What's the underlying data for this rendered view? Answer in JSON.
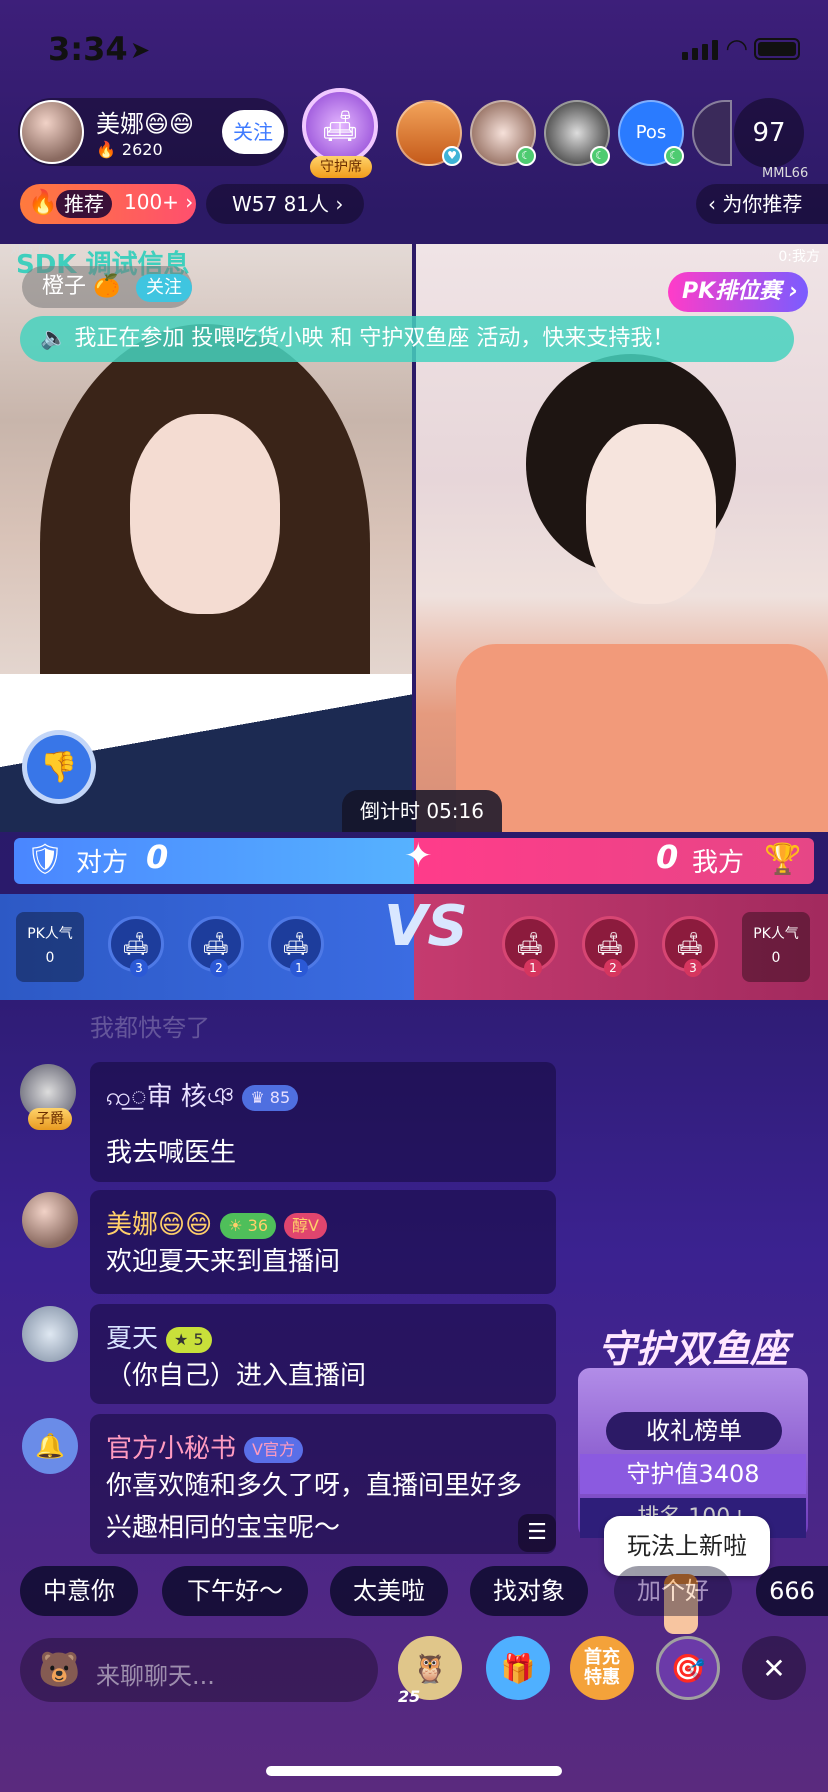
{
  "status_bar": {
    "time": "3:34",
    "location_icon": "location-arrow-icon"
  },
  "host": {
    "name": "美娜😄😄",
    "heat": "2620",
    "follow_label": "关注"
  },
  "guard_seat": {
    "label": "守护席"
  },
  "viewer_count": "97",
  "viewer_tag": "MML66",
  "recommend": {
    "label": "推荐",
    "count": "100+"
  },
  "rank_pill": "W57 81人",
  "for_you": "为你推荐",
  "video": {
    "sdk_debug": "SDK 调试信息",
    "opponent_mini": "对方:0",
    "my_side_mini": "0:我方",
    "opponent_name": "橙子",
    "opponent_follow": "关注",
    "pk_rank_label": "PK排位赛",
    "notice": "我正在参加 投喂吃货小映 和 守护双鱼座 活动，快来支持我！",
    "countdown": "倒计时 05:16"
  },
  "pk": {
    "left_label": "对方",
    "left_score": "0",
    "right_label": "我方",
    "right_score": "0",
    "vs": "VS",
    "left_pop_label": "PK人气",
    "left_pop_value": "0",
    "right_pop_label": "PK人气",
    "right_pop_value": "0",
    "left_seats": [
      "3",
      "2",
      "1"
    ],
    "right_seats": [
      "1",
      "2",
      "3"
    ]
  },
  "chat": {
    "faded": "我都快夸了",
    "messages": [
      {
        "name": "ꩡ꯭审 核ঞ",
        "badge": "85",
        "text": "我去喊医生",
        "rank": "子爵"
      },
      {
        "name": "美娜😄😄",
        "badge": "36",
        "badge2": "醇V",
        "text": "欢迎夏天来到直播间"
      },
      {
        "name": "夏天",
        "badge": "5",
        "text": "（你自己）进入直播间"
      },
      {
        "name": "官方小秘书",
        "badge": "V官方",
        "text": "你喜欢随和多久了呀，直播间里好多兴趣相同的宝宝呢～"
      }
    ]
  },
  "guard_card": {
    "title": "守护双鱼座",
    "rank_board": "收礼榜单",
    "guard_value": "守护值3408",
    "rank_index": "排名 100+",
    "tooltip": "玩法上新啦"
  },
  "quick_replies": [
    "中意你",
    "下午好～",
    "太美啦",
    "找对象",
    "加个好",
    "666"
  ],
  "bottom": {
    "input_placeholder": "来聊聊天...",
    "candy_count": "25",
    "first_recharge": "首充特惠"
  },
  "colors": {
    "accent_blue": "#4a86ff",
    "accent_pink": "#ff3c8a",
    "teal": "#46d2be"
  }
}
